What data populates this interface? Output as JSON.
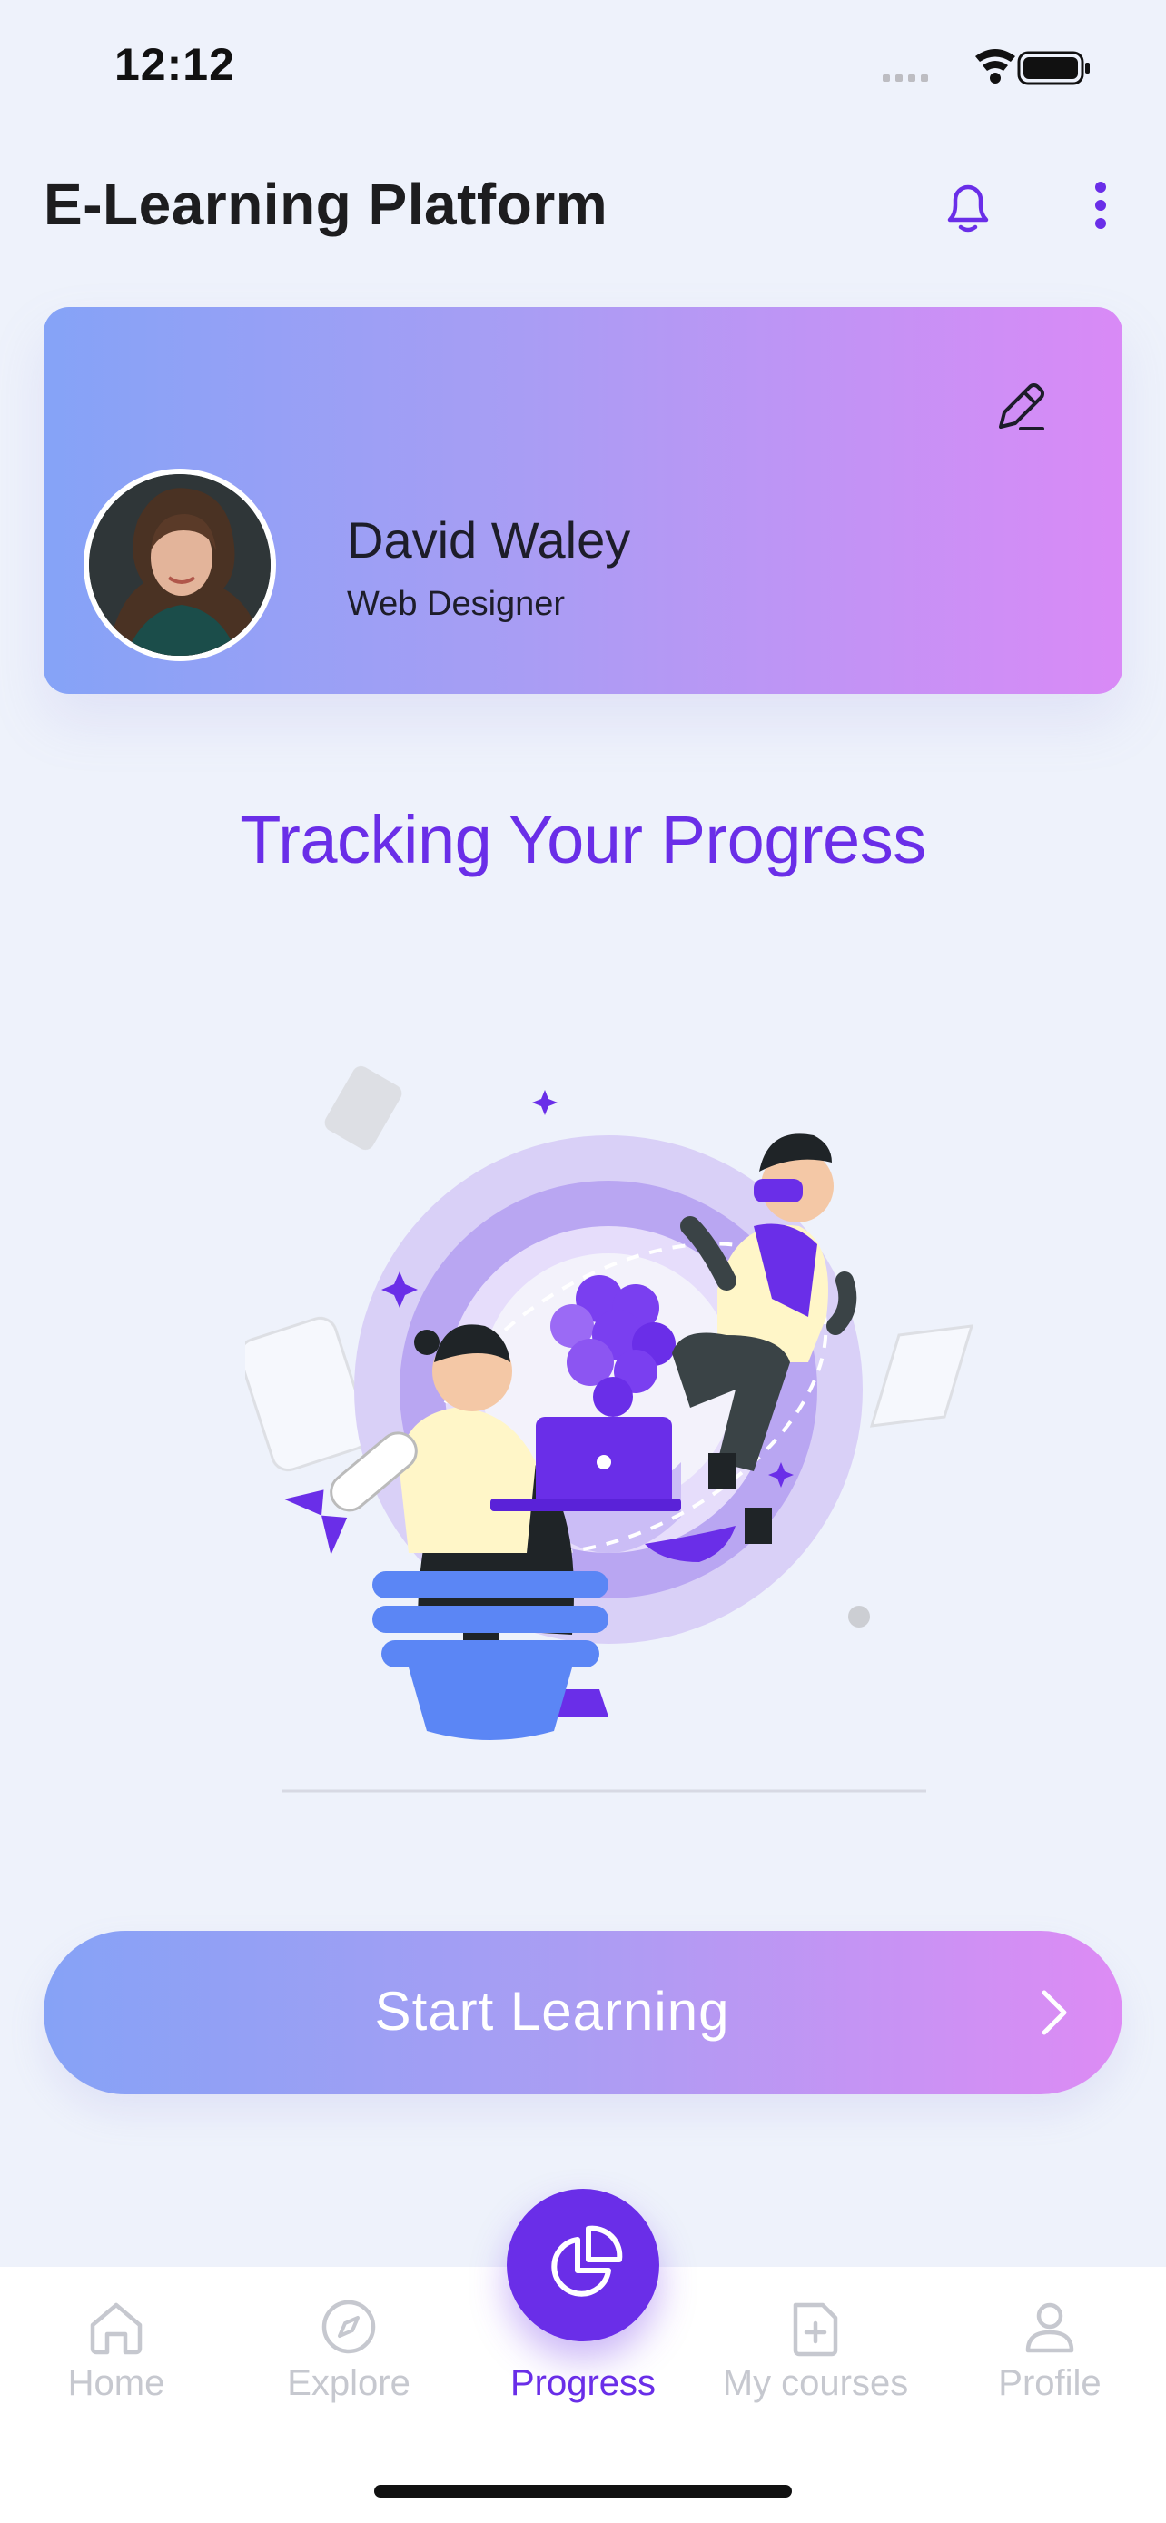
{
  "status_bar": {
    "time": "12:12"
  },
  "header": {
    "title": "E-Learning Platform"
  },
  "profile": {
    "name": "David Waley",
    "role": "Web Designer"
  },
  "headline": "Tracking Your Progress",
  "cta": {
    "label": "Start Learning"
  },
  "nav": {
    "items": [
      {
        "label": "Home",
        "icon": "home-icon",
        "active": false
      },
      {
        "label": "Explore",
        "icon": "compass-icon",
        "active": false
      },
      {
        "label": "Progress",
        "icon": "pie-chart-icon",
        "active": true
      },
      {
        "label": "My courses",
        "icon": "file-plus-icon",
        "active": false
      },
      {
        "label": "Profile",
        "icon": "user-icon",
        "active": false
      }
    ]
  },
  "colors": {
    "accent": "#6a2ee8",
    "gradient_start": "#85a3f7",
    "gradient_end": "#d98af6",
    "inactive_nav": "#c6c8cf"
  }
}
